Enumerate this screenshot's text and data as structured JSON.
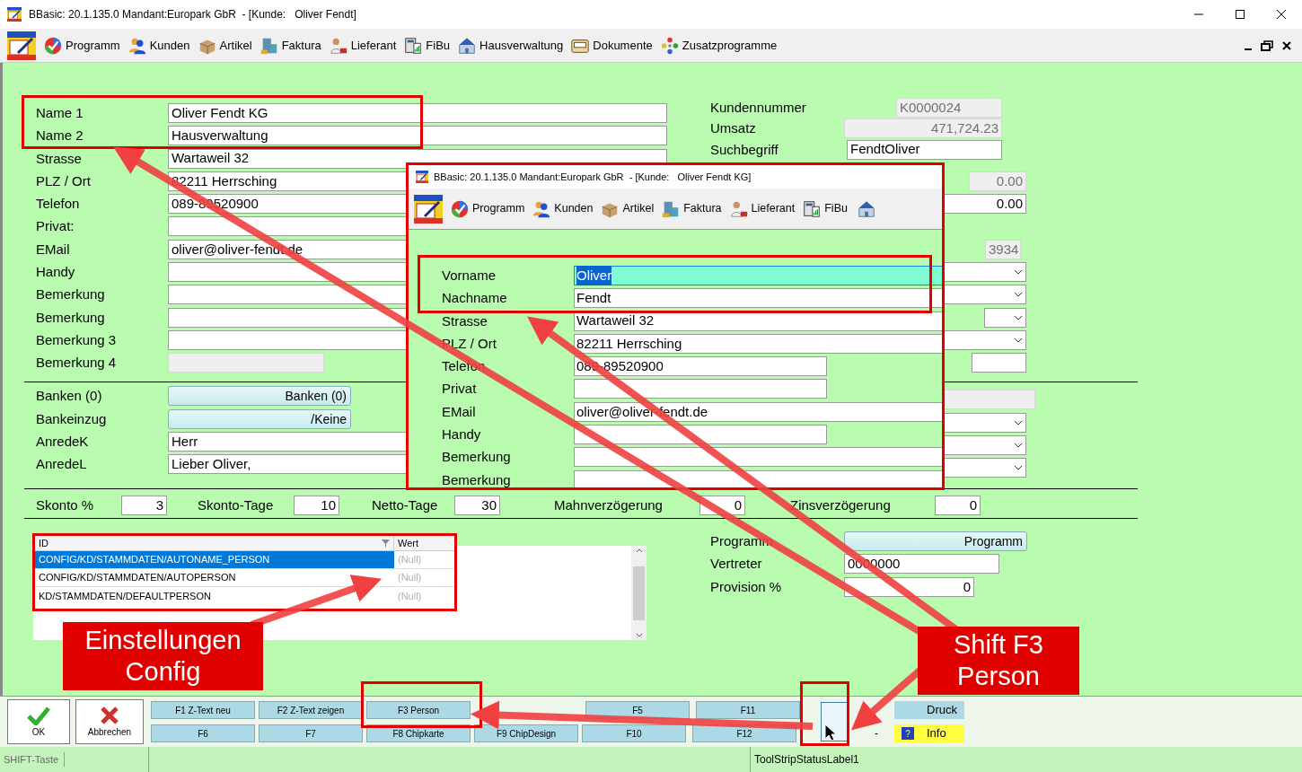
{
  "window": {
    "title": "BBasic: 20.1.135.0 Mandant:Europark GbR  - [Kunde:   Oliver Fendt]"
  },
  "menu": [
    "Programm",
    "Kunden",
    "Artikel",
    "Faktura",
    "Lieferant",
    "FiBu",
    "Hausverwaltung",
    "Dokumente",
    "Zusatzprogramme"
  ],
  "left_fields": [
    {
      "label": "Name 1",
      "value": "Oliver Fendt KG",
      "kind": "text"
    },
    {
      "label": "Name 2",
      "value": "Hausverwaltung",
      "kind": "text"
    },
    {
      "label": "Strasse",
      "value": "Wartaweil 32",
      "kind": "text"
    },
    {
      "label": "PLZ / Ort",
      "value": "82211 Herrsching",
      "kind": "text"
    },
    {
      "label": "Telefon",
      "value": "089-89520900",
      "kind": "text"
    },
    {
      "label": "Privat:",
      "kind": "text"
    },
    {
      "label": "EMail",
      "value": "oliver@oliver-fendt.de",
      "kind": "text"
    },
    {
      "label": "Handy",
      "kind": "text"
    },
    {
      "label": "Bemerkung",
      "kind": "text"
    },
    {
      "label": "Bemerkung",
      "kind": "text"
    },
    {
      "label": "Bemerkung 3",
      "kind": "text"
    },
    {
      "label": "Bemerkung 4",
      "kind": "readonly"
    }
  ],
  "right_fields": [
    {
      "label": "Kundennummer",
      "value": "K0000024",
      "kind": "readonly"
    },
    {
      "label": "Umsatz",
      "value": "471,724.23",
      "kind": "readonly"
    },
    {
      "label": "Suchbegriff",
      "value": "FendtOliver",
      "kind": "text"
    },
    {
      "value": "0.00",
      "kind": "readonly"
    },
    {
      "value": "0.00",
      "kind": "text"
    },
    {
      "kind": "blank"
    },
    {
      "value": "3934",
      "kind": "readonly"
    },
    {
      "kind": "select"
    },
    {
      "kind": "select"
    },
    {
      "kind": "select"
    },
    {
      "kind": "select"
    },
    {
      "kind": "text"
    }
  ],
  "bank_rows": [
    {
      "label": "Banken (0)",
      "value": "Banken (0)",
      "kind": "button"
    },
    {
      "label": "Bankeinzug",
      "value": "/Keine",
      "kind": "button"
    },
    {
      "label": "AnredeK",
      "value": "Herr",
      "kind": "text"
    },
    {
      "label": "AnredeL",
      "value": "Lieber Oliver,",
      "kind": "text"
    }
  ],
  "bank_right": [
    {
      "kind": "readonly"
    },
    {
      "kind": "select"
    },
    {
      "kind": "select"
    },
    {
      "kind": "select"
    }
  ],
  "terms": [
    {
      "label": "Skonto %",
      "value": "3"
    },
    {
      "label": "Skonto-Tage",
      "value": "10"
    },
    {
      "label": "Netto-Tage",
      "value": "30"
    },
    {
      "label": "Mahnverzögerung",
      "value": "0"
    },
    {
      "label": "Zinsverzögerung",
      "value": "0"
    }
  ],
  "lower_right": [
    {
      "label": "Programm",
      "value": "Programm",
      "kind": "button"
    },
    {
      "label": "Vertreter",
      "value": "0000000",
      "kind": "text"
    },
    {
      "label": "Provision %",
      "value": "0",
      "kind": "number"
    }
  ],
  "config_grid": {
    "columns": [
      "ID",
      "Wert"
    ],
    "rows": [
      {
        "id": "CONFIG/KD/STAMMDATEN/AUTONAME_PERSON",
        "value": "(Null)",
        "selected": true
      },
      {
        "id": "CONFIG/KD/STAMMDATEN/AUTOPERSON",
        "value": "(Null)",
        "selected": false
      },
      {
        "id": "KD/STAMMDATEN/DEFAULTPERSON",
        "value": "(Null)",
        "selected": false
      }
    ]
  },
  "person_window": {
    "title": "BBasic: 20.1.135.0 Mandant:Europark GbR  - [Kunde:   Oliver Fendt KG]",
    "menu": [
      "Programm",
      "Kunden",
      "Artikel",
      "Faktura",
      "Lieferant",
      "FiBu"
    ],
    "fields": [
      {
        "label": "Vorname",
        "value": "Oliver",
        "focused": true,
        "kind": "wide"
      },
      {
        "label": "Nachname",
        "value": "Fendt",
        "focused": false,
        "kind": "wide"
      },
      {
        "label": "Strasse",
        "value": "Wartaweil 32",
        "focused": false,
        "kind": "wide"
      },
      {
        "label": "PLZ / Ort",
        "value": "82211 Herrsching",
        "focused": false,
        "kind": "wide"
      },
      {
        "label": "Telefon",
        "value": "089-89520900",
        "focused": false,
        "kind": "short"
      },
      {
        "label": "Privat",
        "focused": false,
        "kind": "short"
      },
      {
        "label": "EMail",
        "value": "oliver@oliver-fendt.de",
        "focused": false,
        "kind": "wide"
      },
      {
        "label": "Handy",
        "focused": false,
        "kind": "short"
      },
      {
        "label": "Bemerkung",
        "focused": false,
        "kind": "wide"
      },
      {
        "label": "Bemerkung",
        "focused": false,
        "kind": "wide"
      }
    ]
  },
  "toolbar": {
    "ok": "OK",
    "cancel": "Abbrechen",
    "keys_row_1": [
      {
        "label": "F1 Z-Text neu"
      },
      {
        "label": "F2 Z-Text zeigen"
      },
      {
        "label": "F3 Person"
      },
      {
        "label": "F5",
        "gap_before": true
      },
      {
        "label": "F11"
      }
    ],
    "keys_row_2": [
      {
        "label": "F6"
      },
      {
        "label": "F7"
      },
      {
        "label": "F8 Chipkarte"
      },
      {
        "label": "F9 ChipDesign"
      },
      {
        "label": "F10"
      },
      {
        "label": "F12"
      }
    ],
    "dash": "-",
    "print": "Druck",
    "info_icon": "?",
    "info": "Info"
  },
  "status_bar": [
    "SHIFT-Taste",
    "ToolStripStatusLabel1"
  ],
  "callouts": [
    "Einstellungen Config",
    "Shift F3 Person"
  ]
}
